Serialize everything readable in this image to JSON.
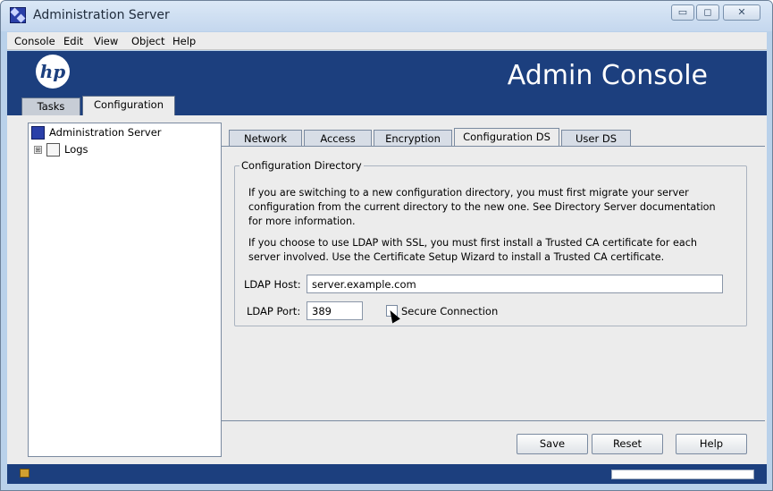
{
  "window": {
    "title": "Administration Server",
    "minimize": "▭",
    "maximize": "◻",
    "close": "✕"
  },
  "menu": [
    "Console",
    "Edit",
    "View",
    "Object",
    "Help"
  ],
  "banner": {
    "logo": "hp",
    "title": "Admin Console"
  },
  "main_tabs": [
    {
      "label": "Tasks",
      "active": false
    },
    {
      "label": "Configuration",
      "active": true
    }
  ],
  "tree": [
    {
      "label": "Administration Server",
      "icon": "server-icon"
    },
    {
      "label": "Logs",
      "icon": "folder-icon",
      "expander": "⊞"
    }
  ],
  "sub_tabs": [
    {
      "label": "Network",
      "active": false
    },
    {
      "label": "Access",
      "active": false
    },
    {
      "label": "Encryption",
      "active": false
    },
    {
      "label": "Configuration DS",
      "active": true
    },
    {
      "label": "User DS",
      "active": false
    }
  ],
  "config_directory": {
    "group_title": "Configuration Directory",
    "paragraph1": "If you are switching to a new configuration directory, you must first migrate your server configuration from the current directory to the new one. See Directory Server documentation for more information.",
    "paragraph2": "If you choose to use LDAP with SSL, you must first install a Trusted CA certificate for each server involved. Use the Certificate Setup Wizard to install a Trusted CA certificate.",
    "ldap_host_label": "LDAP Host:",
    "ldap_host_value": "server.example.com",
    "ldap_port_label": "LDAP Port:",
    "ldap_port_value": "389",
    "secure_connection_label": "Secure Connection",
    "secure_connection_checked": false
  },
  "buttons": {
    "save": "Save",
    "reset": "Reset",
    "help": "Help"
  },
  "status": {
    "progress": 0
  },
  "colors": {
    "banner": "#1c3f7e",
    "panel": "#ececec"
  }
}
